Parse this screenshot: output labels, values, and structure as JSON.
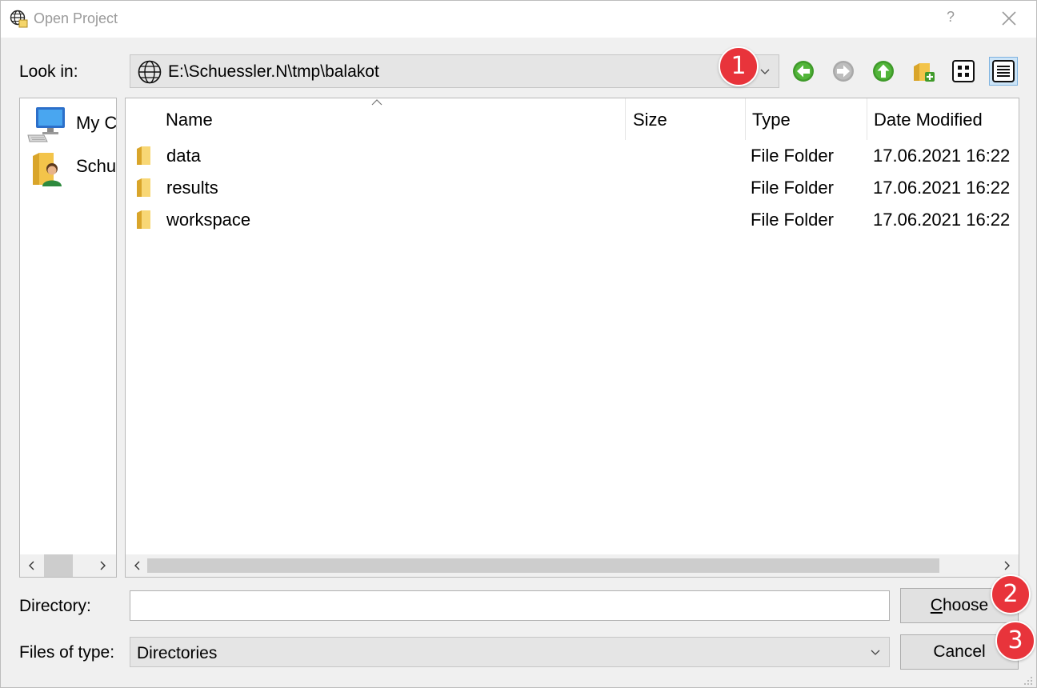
{
  "window": {
    "title": "Open Project",
    "help_glyph": "?",
    "icons": {
      "app": "globe-icon",
      "close": "close-icon"
    }
  },
  "lookin": {
    "label": "Look in:",
    "path": "E:\\Schuessler.N\\tmp\\balakot",
    "icon": "globe-icon"
  },
  "toolbar": {
    "buttons": [
      "back-arrow-icon",
      "forward-arrow-icon",
      "up-arrow-icon",
      "new-folder-icon",
      "list-view-icon",
      "detail-view-icon"
    ],
    "active": "detail-view-icon"
  },
  "badges": [
    "1",
    "2",
    "3"
  ],
  "sidebar": {
    "items": [
      {
        "label": "My C",
        "icon": "computer-icon"
      },
      {
        "label": "Schu",
        "icon": "user-folder-icon"
      }
    ]
  },
  "filelist": {
    "columns": [
      "Name",
      "Size",
      "Type",
      "Date Modified"
    ],
    "rows": [
      {
        "name": "data",
        "size": "",
        "type": "File Folder",
        "modified": "17.06.2021 16:22"
      },
      {
        "name": "results",
        "size": "",
        "type": "File Folder",
        "modified": "17.06.2021 16:22"
      },
      {
        "name": "workspace",
        "size": "",
        "type": "File Folder",
        "modified": "17.06.2021 16:22"
      }
    ]
  },
  "directory": {
    "label": "Directory:",
    "value": ""
  },
  "filetype": {
    "label": "Files of type:",
    "value": "Directories"
  },
  "buttons": {
    "choose_mnemonic": "C",
    "choose_rest": "hoose",
    "cancel": "Cancel"
  },
  "colors": {
    "badge": "#e8343b",
    "accent": "#cce4f7",
    "folder": "#f8d775"
  }
}
